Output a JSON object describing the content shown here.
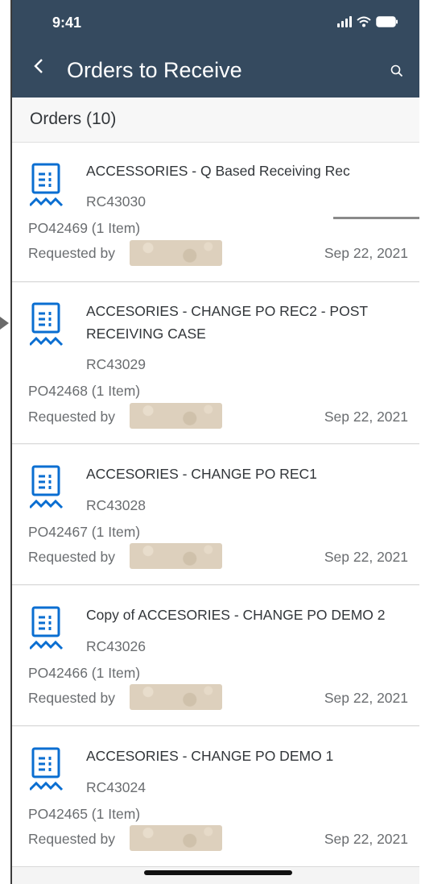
{
  "status_bar": {
    "time": "9:41"
  },
  "header": {
    "title": "Orders to Receive"
  },
  "section": {
    "title": "Orders (10)"
  },
  "orders": [
    {
      "title": "ACCESSORIES - Q Based Receiving Rec",
      "code": "RC43030",
      "po": "PO42469 (1 Item)",
      "requested_label": "Requested by",
      "date": "Sep 22, 2021"
    },
    {
      "title": "ACCESORIES - CHANGE PO REC2 - POST RECEIVING CASE",
      "code": "RC43029",
      "po": "PO42468 (1 Item)",
      "requested_label": "Requested by",
      "date": "Sep 22, 2021"
    },
    {
      "title": "ACCESORIES - CHANGE PO REC1",
      "code": "RC43028",
      "po": "PO42467 (1 Item)",
      "requested_label": "Requested by",
      "date": "Sep 22, 2021"
    },
    {
      "title": "Copy of ACCESORIES - CHANGE PO DEMO 2",
      "code": "RC43026",
      "po": "PO42466 (1 Item)",
      "requested_label": "Requested by",
      "date": "Sep 22, 2021"
    },
    {
      "title": "ACCESORIES - CHANGE PO DEMO 1",
      "code": "RC43024",
      "po": "PO42465 (1 Item)",
      "requested_label": "Requested by",
      "date": "Sep 22, 2021"
    }
  ],
  "icons": {
    "back": "chevron-left-icon",
    "search": "search-icon",
    "order": "receipt-icon"
  },
  "colors": {
    "header_bg": "#354a5f",
    "icon_blue": "#0a6ed1",
    "text_primary": "#32363a",
    "text_secondary": "#6a6d70"
  }
}
